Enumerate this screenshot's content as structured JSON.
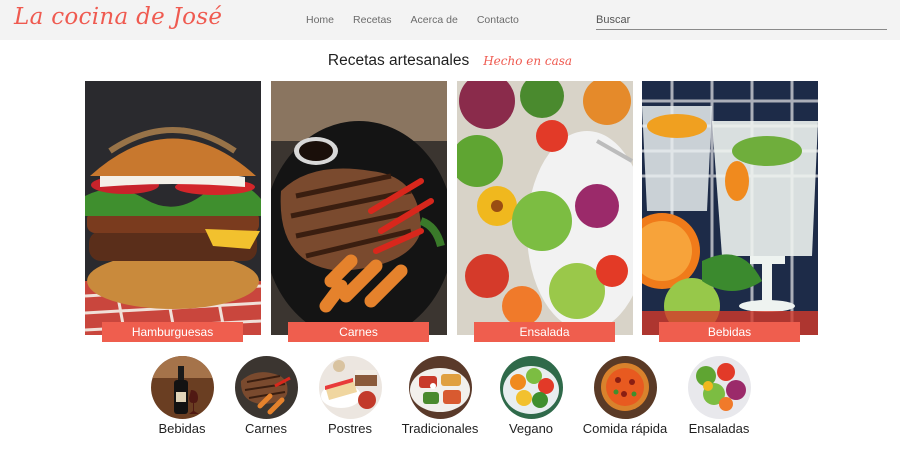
{
  "header": {
    "logo": "La cocina de José",
    "nav": [
      "Home",
      "Recetas",
      "Acerca de",
      "Contacto"
    ],
    "search_placeholder": "Buscar"
  },
  "hero": {
    "title": "Recetas artesanales",
    "tagline": "Hecho en casa"
  },
  "cards": [
    {
      "label": "Hamburguesas",
      "icon": "burger-photo"
    },
    {
      "label": "Carnes",
      "icon": "steak-photo"
    },
    {
      "label": "Ensalada",
      "icon": "salad-photo"
    },
    {
      "label": "Bebidas",
      "icon": "drinks-photo"
    }
  ],
  "categories": [
    {
      "label": "Bebidas",
      "icon": "wine-bottle-photo"
    },
    {
      "label": "Carnes",
      "icon": "steak-photo"
    },
    {
      "label": "Postres",
      "icon": "cake-photo"
    },
    {
      "label": "Tradicionales",
      "icon": "traditional-dish-photo"
    },
    {
      "label": "Vegano",
      "icon": "vegan-bowl-photo"
    },
    {
      "label": "Comida rápida",
      "icon": "pizza-photo"
    },
    {
      "label": "Ensaladas",
      "icon": "salad-photo"
    }
  ],
  "colors": {
    "accent": "#ef5e4e",
    "header_bg": "#f3f3f3"
  }
}
